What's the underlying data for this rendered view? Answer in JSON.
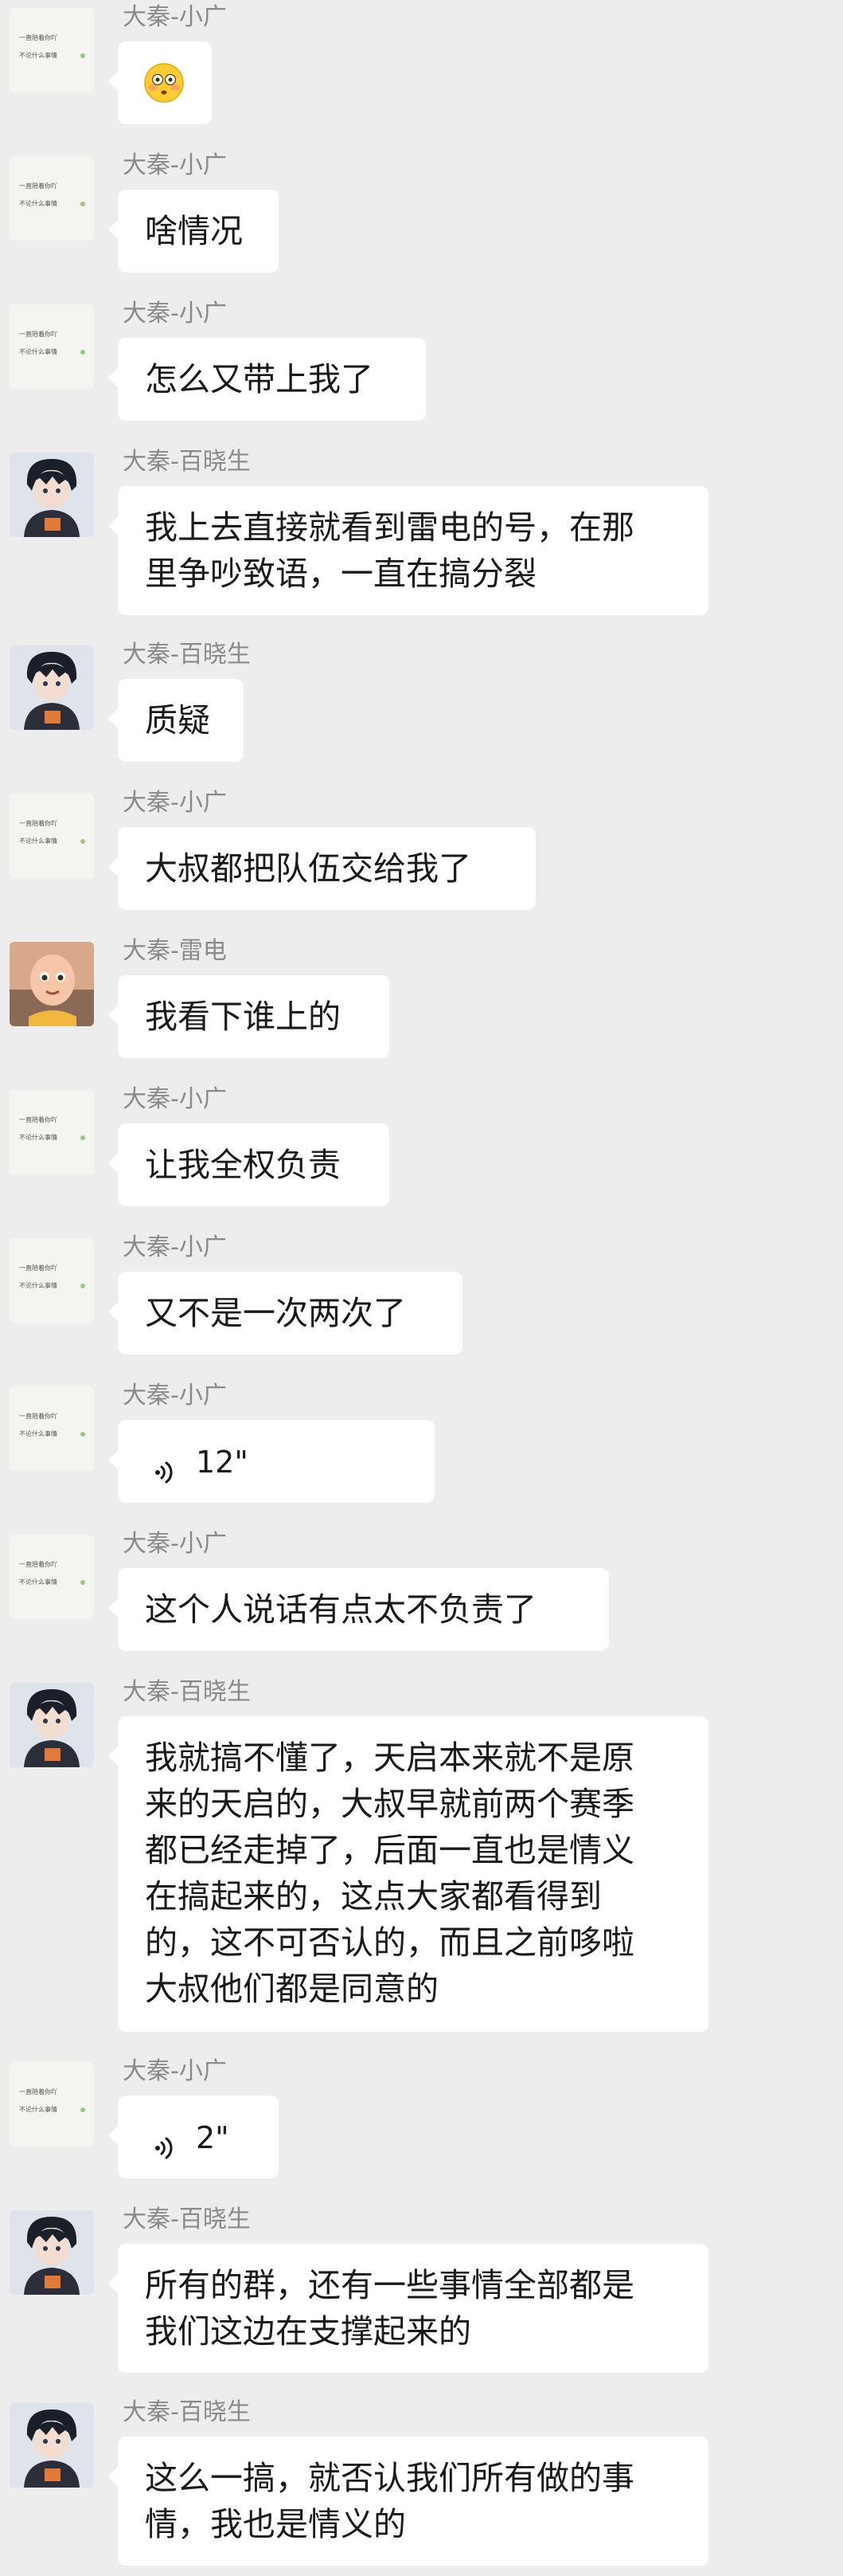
{
  "users": {
    "xiaoguang": "大秦-小广",
    "baixiaosheng": "大秦-百晓生",
    "leidian": "大秦-雷电"
  },
  "messages": [
    {
      "sender": "大秦-小广",
      "type": "emoji",
      "emoji": "😳"
    },
    {
      "sender": "大秦-小广",
      "type": "text",
      "lines": [
        "啥情况"
      ]
    },
    {
      "sender": "大秦-小广",
      "type": "text",
      "lines": [
        "怎么又带上我了"
      ]
    },
    {
      "sender": "大秦-百晓生",
      "type": "text",
      "lines": [
        "我上去直接就看到雷电的号，在那",
        "里争吵致语，一直在搞分裂"
      ]
    },
    {
      "sender": "大秦-百晓生",
      "type": "text",
      "lines": [
        "质疑"
      ]
    },
    {
      "sender": "大秦-小广",
      "type": "text",
      "lines": [
        "大叔都把队伍交给我了"
      ]
    },
    {
      "sender": "大秦-雷电",
      "type": "text",
      "lines": [
        "我看下谁上的"
      ]
    },
    {
      "sender": "大秦-小广",
      "type": "text",
      "lines": [
        "让我全权负责"
      ]
    },
    {
      "sender": "大秦-小广",
      "type": "text",
      "lines": [
        "又不是一次两次了"
      ]
    },
    {
      "sender": "大秦-小广",
      "type": "voice",
      "duration": "12\""
    },
    {
      "sender": "大秦-小广",
      "type": "text",
      "lines": [
        "这个人说话有点太不负责了"
      ]
    },
    {
      "sender": "大秦-百晓生",
      "type": "text",
      "lines": [
        "我就搞不懂了，天启本来就不是原",
        "来的天启的，大叔早就前两个赛季",
        "都已经走掉了，后面一直也是情义",
        "在搞起来的，这点大家都看得到",
        "的，这不可否认的，而且之前哆啦",
        "大叔他们都是同意的"
      ]
    },
    {
      "sender": "大秦-小广",
      "type": "voice",
      "duration": "2\""
    },
    {
      "sender": "大秦-百晓生",
      "type": "text",
      "lines": [
        "所有的群，还有一些事情全部都是",
        "我们这边在支撑起来的"
      ]
    },
    {
      "sender": "大秦-百晓生",
      "type": "text",
      "lines": [
        "这么一搞，就否认我们所有做的事",
        "情，我也是情义的"
      ]
    }
  ],
  "colors": {
    "background": "#ededed",
    "bubble": "#ffffff",
    "name_text": "#8a8a8a",
    "message_text": "#1a1a1a"
  }
}
